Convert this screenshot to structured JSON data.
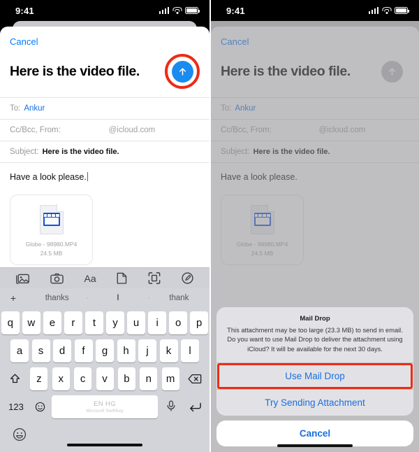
{
  "theme": {
    "accent_blue": "#1a6fe0",
    "send_blue": "#1a8cf0",
    "highlight_red": "#ee2b14",
    "keyboard_bg": "#d2d4d9",
    "video_badge_blue": "#1352d8"
  },
  "status_bar": {
    "time": "9:41",
    "signal_icon": "cellular-bars-icon",
    "wifi_icon": "wifi-icon",
    "battery_icon": "battery-icon"
  },
  "left_phone": {
    "compose": {
      "cancel_label": "Cancel",
      "title": "Here is the video file.",
      "send_icon": "send-arrow-up-icon",
      "fields": {
        "to_label": "To:",
        "to_value": "Ankur",
        "ccbcc_label": "Cc/Bcc, From:",
        "from_value": "@icloud.com",
        "subject_label": "Subject:",
        "subject_value": "Here is the video file."
      },
      "body_text": "Have a look please.",
      "attachment": {
        "icon": "video-file-icon",
        "name": "Globe - 98980.MP4",
        "size": "24.5 MB"
      }
    },
    "toolbar_icons": [
      {
        "name": "photos-icon"
      },
      {
        "name": "camera-icon"
      },
      {
        "name": "text-format-aa-icon",
        "label": "Aa"
      },
      {
        "name": "document-icon"
      },
      {
        "name": "scan-document-icon"
      },
      {
        "name": "markup-pen-icon"
      }
    ],
    "suggestions": {
      "plus": "+",
      "left": "thanks",
      "middle": "I",
      "right": "thank"
    },
    "keyboard": {
      "row1": [
        "q",
        "w",
        "e",
        "r",
        "t",
        "y",
        "u",
        "i",
        "o",
        "p"
      ],
      "row2": [
        "a",
        "s",
        "d",
        "f",
        "g",
        "h",
        "j",
        "k",
        "l"
      ],
      "row3": [
        "z",
        "x",
        "c",
        "v",
        "b",
        "n",
        "m"
      ],
      "shift_icon": "shift-arrow-icon",
      "backspace_icon": "backspace-delete-icon",
      "numbers_key": "123",
      "emoji_key_icon": "emoji-smiley-icon",
      "space_language": "EN HG",
      "space_brand": "Microsoft SwiftKey",
      "mic_icon": "microphone-icon",
      "return_icon": "return-enter-icon"
    },
    "bottom": {
      "emoji_icon": "emoji-face-icon",
      "home_indicator": "home-indicator"
    }
  },
  "right_phone": {
    "compose": {
      "cancel_label": "Cancel",
      "title": "Here is the video file.",
      "send_icon": "send-arrow-up-icon",
      "fields": {
        "to_label": "To:",
        "to_value": "Ankur",
        "ccbcc_label": "Cc/Bcc, From:",
        "from_value": "@icloud.com",
        "subject_label": "Subject:",
        "subject_value": "Here is the video file."
      },
      "body_text": "Have a look please.",
      "attachment": {
        "icon": "video-file-icon",
        "name": "Globe - 98980.MP4",
        "size": "24.5 MB"
      }
    },
    "alert": {
      "title": "Mail Drop",
      "message": "This attachment may be too large (23.3 MB) to send in email. Do you want to use Mail Drop to deliver the attachment using iCloud? It will be available for the next 30 days.",
      "primary_action": "Use Mail Drop",
      "secondary_action": "Try Sending Attachment",
      "cancel_action": "Cancel"
    },
    "home_indicator": "home-indicator"
  }
}
